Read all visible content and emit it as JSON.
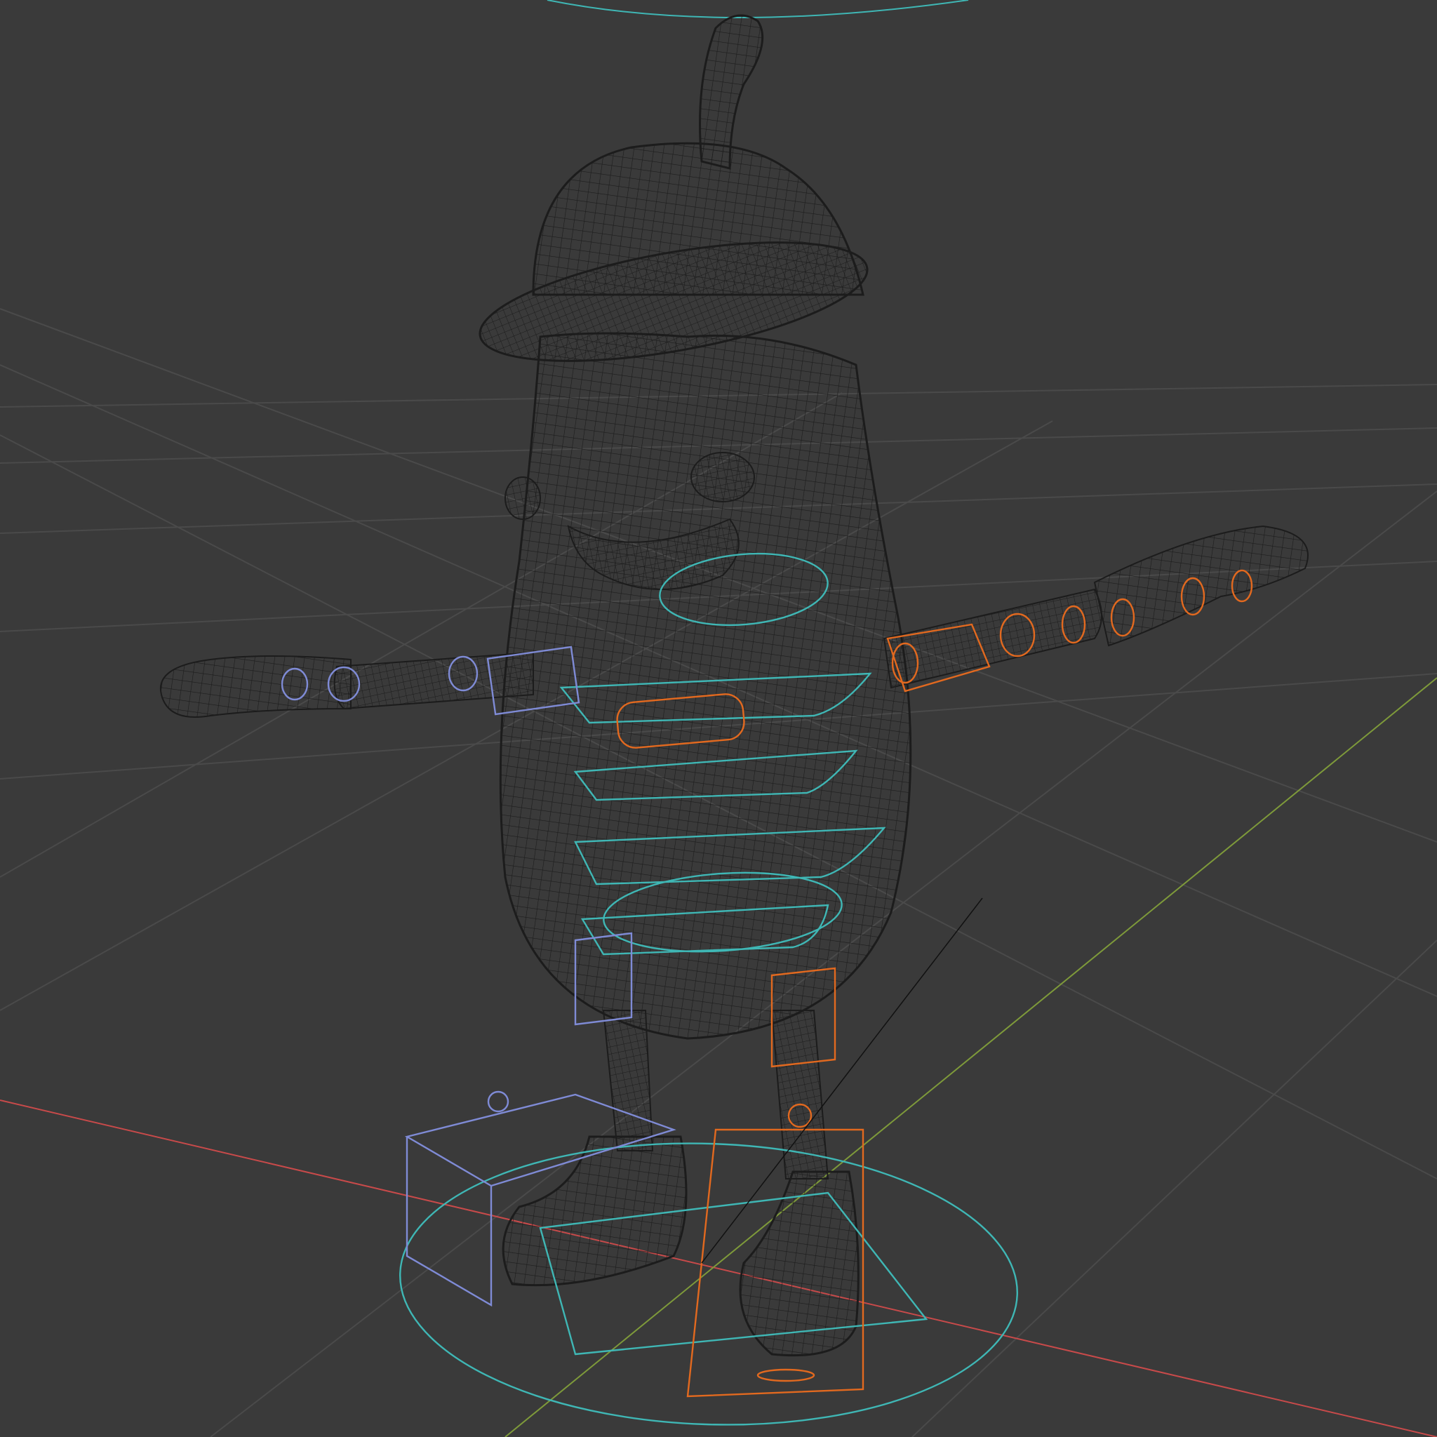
{
  "viewport": {
    "mode": "wireframe",
    "background_color": "#3a3a3a",
    "grid_color": "#4a4a4a",
    "axes": {
      "x_color": "#c84a4a",
      "y_color": "#7e9a3a"
    }
  },
  "colors": {
    "mesh_wire": "#1c1c1c",
    "control_cyan": "#3fb7b5",
    "control_orange": "#e2691f",
    "control_blue": "#7f8bd6",
    "bone_line": "#111111"
  },
  "scene": {
    "object": "character-mesh",
    "rig_controls": [
      "root-circle",
      "spine-controls",
      "left-arm-controls",
      "right-arm-controls",
      "left-foot-ik-box",
      "right-foot-ik-box",
      "head-circle"
    ]
  }
}
